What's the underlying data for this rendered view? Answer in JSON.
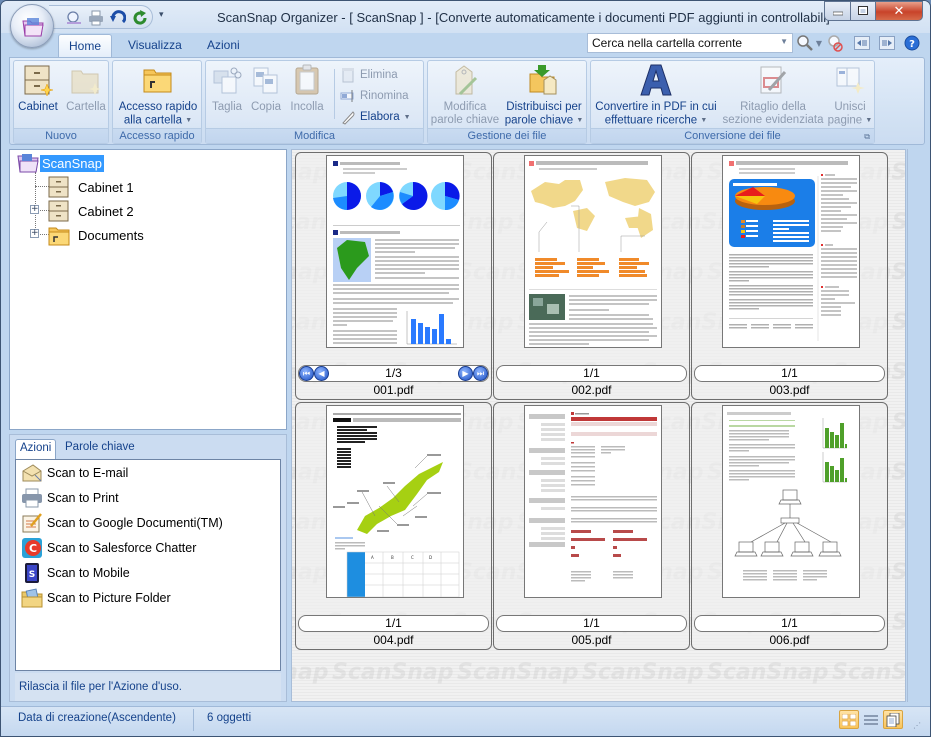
{
  "window": {
    "title": "ScanSnap Organizer - [ ScanSnap ]  - [Converte automaticamente i documenti PDF aggiunti in controllabili]",
    "controls": {
      "minimize": "minimize",
      "maximize": "maximize",
      "close": "close"
    }
  },
  "quick_access": {
    "buttons": [
      "search-view-icon",
      "print-icon",
      "undo-icon",
      "refresh-icon"
    ],
    "more": "▾"
  },
  "tabs": [
    {
      "label": "Home",
      "active": true
    },
    {
      "label": "Visualizza",
      "active": false
    },
    {
      "label": "Azioni",
      "active": false
    }
  ],
  "search": {
    "value": "Cerca nella cartella corrente"
  },
  "ribbon": {
    "groups": [
      {
        "label": "Nuovo",
        "buttons": [
          {
            "label": "Cabinet",
            "enabled": true
          },
          {
            "label": "Cartella",
            "enabled": false
          }
        ]
      },
      {
        "label": "Accesso rapido",
        "buttons": [
          {
            "label_line1": "Accesso rapido",
            "label_line2": "alla cartella",
            "enabled": true,
            "dropdown": true
          }
        ]
      },
      {
        "label": "Modifica",
        "buttons": [
          {
            "label": "Taglia",
            "enabled": false
          },
          {
            "label": "Copia",
            "enabled": false
          },
          {
            "label": "Incolla",
            "enabled": false
          }
        ],
        "small_buttons": [
          {
            "label": "Elimina",
            "enabled": false
          },
          {
            "label": "Rinomina",
            "enabled": false
          },
          {
            "label": "Elabora",
            "enabled": true,
            "dropdown": true
          }
        ]
      },
      {
        "label": "Gestione dei file",
        "buttons": [
          {
            "label_line1": "Modifica",
            "label_line2": "parole chiave",
            "enabled": false
          },
          {
            "label_line1": "Distribuisci per",
            "label_line2": "parole chiave",
            "enabled": true,
            "dropdown": true
          }
        ]
      },
      {
        "label": "Conversione dei file",
        "buttons": [
          {
            "label_line1": "Convertire in PDF in cui",
            "label_line2": "effettuare ricerche",
            "enabled": true,
            "dropdown": true
          },
          {
            "label_line1": "Ritaglio della",
            "label_line2": "sezione evidenziata",
            "enabled": false
          },
          {
            "label_line1": "Unisci",
            "label_line2": "pagine",
            "enabled": false,
            "dropdown": true
          }
        ]
      }
    ]
  },
  "tree": {
    "root": "ScanSnap",
    "items": [
      {
        "label": "Cabinet 1",
        "expandable": false
      },
      {
        "label": "Cabinet 2",
        "expandable": true
      },
      {
        "label": "Documents",
        "expandable": true
      }
    ]
  },
  "actions_pane": {
    "tabs": [
      {
        "label": "Azioni",
        "active": true
      },
      {
        "label": "Parole chiave",
        "active": false
      }
    ],
    "items": [
      {
        "label": "Scan to E-mail",
        "icon": "email-icon"
      },
      {
        "label": "Scan to Print",
        "icon": "printer-icon"
      },
      {
        "label": "Scan to Google Documenti(TM)",
        "icon": "google-docs-icon"
      },
      {
        "label": "Scan to Salesforce Chatter",
        "icon": "salesforce-chatter-icon"
      },
      {
        "label": "Scan to Mobile",
        "icon": "mobile-icon"
      },
      {
        "label": "Scan to Picture Folder",
        "icon": "picture-folder-icon"
      }
    ],
    "hint": "Rilascia il file per l'Azione d'uso."
  },
  "files": [
    {
      "name": "001.pdf",
      "page": "1/3",
      "has_nav": true
    },
    {
      "name": "002.pdf",
      "page": "1/1",
      "has_nav": false
    },
    {
      "name": "003.pdf",
      "page": "1/1",
      "has_nav": false
    },
    {
      "name": "004.pdf",
      "page": "1/1",
      "has_nav": false
    },
    {
      "name": "005.pdf",
      "page": "1/1",
      "has_nav": false
    },
    {
      "name": "006.pdf",
      "page": "1/1",
      "has_nav": false
    }
  ],
  "watermark": "ScanSnap",
  "status": {
    "sort": "Data di creazione(Ascendente)",
    "count": "6 oggetti"
  },
  "colors": {
    "accent": "#15428b",
    "selection": "#3399ff"
  }
}
